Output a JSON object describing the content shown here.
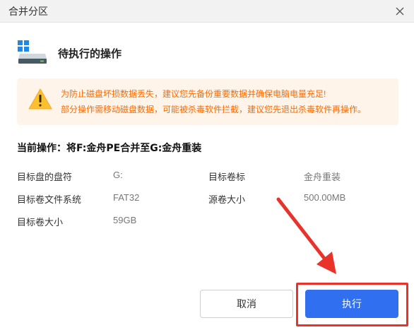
{
  "window": {
    "title": "合并分区"
  },
  "header": {
    "title": "待执行的操作"
  },
  "warning": {
    "line1": "为防止磁盘坏损数据丢失，建议您先备份重要数据并确保电脑电量充足!",
    "line2": "部分操作需移动磁盘数据，可能被杀毒软件拦截，建议您先退出杀毒软件再操作。"
  },
  "operation": {
    "title": "当前操作：将F:金舟PE合并至G:金舟重装"
  },
  "details": {
    "target_disk_label": "目标盘的盘符",
    "target_disk_value": "G:",
    "target_volume_label": "目标卷标",
    "target_volume_value": "金舟重装",
    "fs_label": "目标卷文件系统",
    "fs_value": "FAT32",
    "source_size_label": "源卷大小",
    "source_size_value": "500.00MB",
    "target_size_label": "目标卷大小",
    "target_size_value": "59GB"
  },
  "buttons": {
    "cancel": "取消",
    "execute": "执行"
  },
  "colors": {
    "accent": "#2f6ff0",
    "warning_text": "#ff6a00",
    "warning_bg": "#fff4e9",
    "highlight": "#e8322a"
  },
  "icons": {
    "close": "close-icon",
    "disk": "windows-disk-icon",
    "warning": "warning-triangle-icon"
  }
}
